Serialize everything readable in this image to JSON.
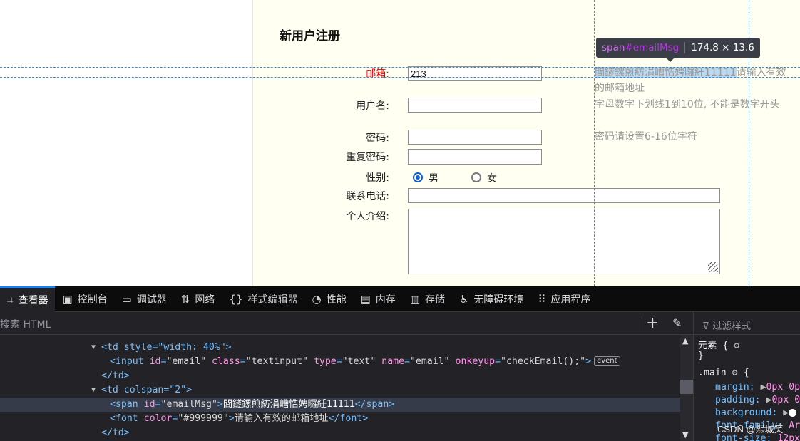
{
  "form": {
    "title": "新用户注册",
    "labels": {
      "email": "邮箱:",
      "username": "用户名:",
      "password": "密码:",
      "confirm_password": "重复密码:",
      "gender": "性别:",
      "phone": "联系电话:",
      "intro": "个人介绍:"
    },
    "email_value": "213",
    "email_msg": "閭鐩鏍煎紡涓嶆悎娉曪紝11111",
    "email_hint": "请输入有效的邮箱地址",
    "username_hint": "字母数字下划线1到10位, 不能是数字开头",
    "password_hint": "密码请设置6-16位字符",
    "gender_options": [
      "男",
      "女"
    ]
  },
  "inspector_tooltip": {
    "tag": "span",
    "id": "#emailMsg",
    "size": "174.8 × 13.6"
  },
  "devtools": {
    "tabs": [
      {
        "icon": "inspector-icon",
        "glyph": "⌗",
        "label": "查看器"
      },
      {
        "icon": "console-icon",
        "glyph": "▣",
        "label": "控制台"
      },
      {
        "icon": "debugger-icon",
        "glyph": "▭",
        "label": "调试器"
      },
      {
        "icon": "network-icon",
        "glyph": "⇅",
        "label": "网络"
      },
      {
        "icon": "style-editor-icon",
        "glyph": "{}",
        "label": "样式编辑器"
      },
      {
        "icon": "performance-icon",
        "glyph": "◔",
        "label": "性能"
      },
      {
        "icon": "memory-icon",
        "glyph": "▤",
        "label": "内存"
      },
      {
        "icon": "storage-icon",
        "glyph": "▥",
        "label": "存储"
      },
      {
        "icon": "accessibility-icon",
        "glyph": "♿",
        "label": "无障碍环境"
      },
      {
        "icon": "application-icon",
        "glyph": "⠿",
        "label": "应用程序"
      }
    ],
    "search_placeholder": "搜索 HTML",
    "filter_styles": "过滤样式",
    "markup": {
      "td1_open": "<td style=\"width: 40%\">",
      "input_tag": "input",
      "input_attrs": [
        {
          "name": "id",
          "value": "\"email\""
        },
        {
          "name": "class",
          "value": "\"textinput\""
        },
        {
          "name": "type",
          "value": "\"text\""
        },
        {
          "name": "name",
          "value": "\"email\""
        },
        {
          "name": "onkeyup",
          "value": "\"checkEmail();\""
        }
      ],
      "event_badge": "event",
      "td_close": "</td>",
      "td2_open": "<td colspan=\"2\">",
      "span_open_tag": "<span",
      "span_attr_name": "id",
      "span_attr_value": "\"emailMsg\"",
      "span_text": "閭鐩鏍煎紡涓嶆悎娉曪紝11111",
      "span_close": "</span>",
      "font_open_tag": "<font",
      "font_attr_name": "color",
      "font_attr_value": "\"#999999\"",
      "font_text": "请输入有效的邮箱地址",
      "font_close": "</font>",
      "td_close2": "</td>"
    },
    "rules": {
      "element_selector": "元素 {",
      "element_close": "}",
      "main_selector": ".main",
      "main_open": "{",
      "props": [
        {
          "name": "margin:",
          "value": "0px 0p"
        },
        {
          "name": "padding:",
          "value": "0px 0"
        },
        {
          "name": "background:",
          "value": ""
        },
        {
          "name": "font-family:",
          "value": "Ar"
        },
        {
          "name": "font-size:",
          "value": "12px"
        }
      ]
    },
    "watermark": "CSDN @熙城笑"
  }
}
